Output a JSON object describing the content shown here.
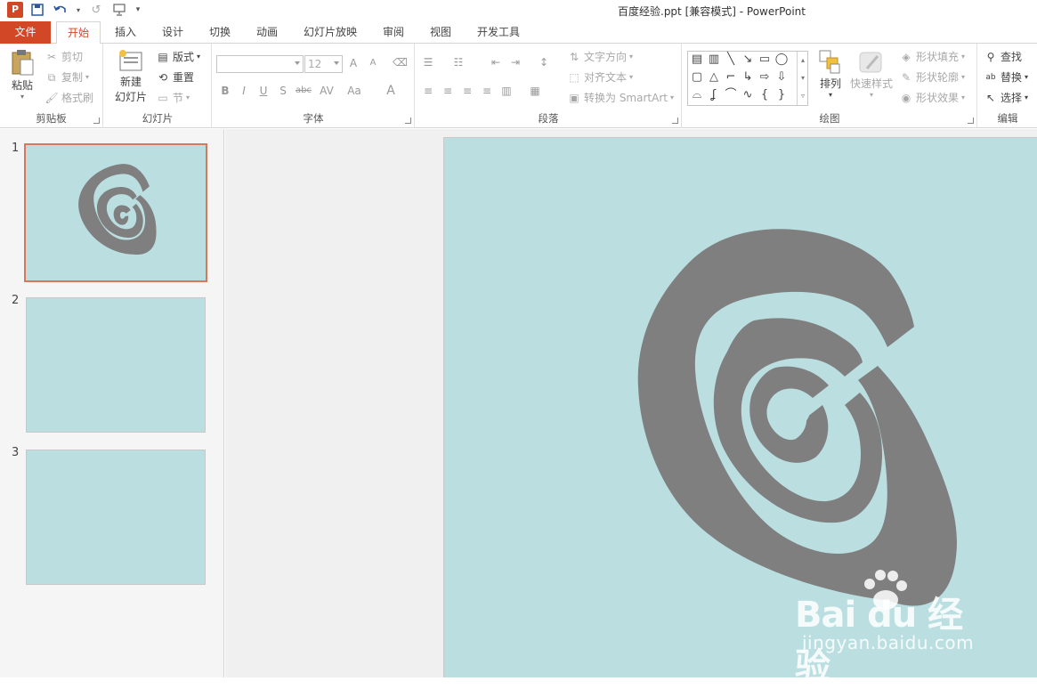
{
  "app": {
    "title": "百度经验.ppt [兼容模式] - PowerPoint",
    "logo": "P"
  },
  "qat": {
    "save_icon": "save-icon",
    "undo_icon": "undo-icon",
    "redo_icon": "redo-icon",
    "present_icon": "present-from-start-icon"
  },
  "tabs": [
    {
      "label": "文件"
    },
    {
      "label": "开始"
    },
    {
      "label": "插入"
    },
    {
      "label": "设计"
    },
    {
      "label": "切换"
    },
    {
      "label": "动画"
    },
    {
      "label": "幻灯片放映"
    },
    {
      "label": "审阅"
    },
    {
      "label": "视图"
    },
    {
      "label": "开发工具"
    }
  ],
  "clipboard": {
    "label": "剪贴板",
    "paste": "粘贴",
    "cut": "剪切",
    "copy": "复制",
    "format_painter": "格式刷"
  },
  "slides_group": {
    "label": "幻灯片",
    "new_slide_line1": "新建",
    "new_slide_line2": "幻灯片",
    "layout": "版式",
    "reset": "重置",
    "section": "节"
  },
  "font": {
    "label": "字体",
    "font_name": "",
    "font_size": "12",
    "bold": "B",
    "italic": "I",
    "underline": "U",
    "shadow": "S",
    "strike": "abc",
    "spacing": "AV",
    "case": "Aa",
    "color": "A",
    "grow": "A",
    "shrink": "A"
  },
  "paragraph": {
    "label": "段落",
    "text_direction": "文字方向",
    "align_text": "对齐文本",
    "smartart": "转换为 SmartArt"
  },
  "drawing": {
    "label": "绘图",
    "arrange": "排列",
    "quick_styles": "快速样式",
    "shape_fill": "形状填充",
    "shape_outline": "形状轮廓",
    "shape_effects": "形状效果"
  },
  "editing": {
    "label": "编辑",
    "find": "查找",
    "replace": "替换",
    "select": "选择"
  },
  "thumbnails": [
    {
      "number": "1",
      "selected": true
    },
    {
      "number": "2",
      "selected": false
    },
    {
      "number": "3",
      "selected": false
    }
  ],
  "watermark": {
    "logo": "Bai du 经验",
    "url": "jingyan.baidu.com"
  },
  "colors": {
    "accent": "#d24726",
    "slide_bg": "#bbdfe1",
    "spiral": "#7f7f7f"
  }
}
